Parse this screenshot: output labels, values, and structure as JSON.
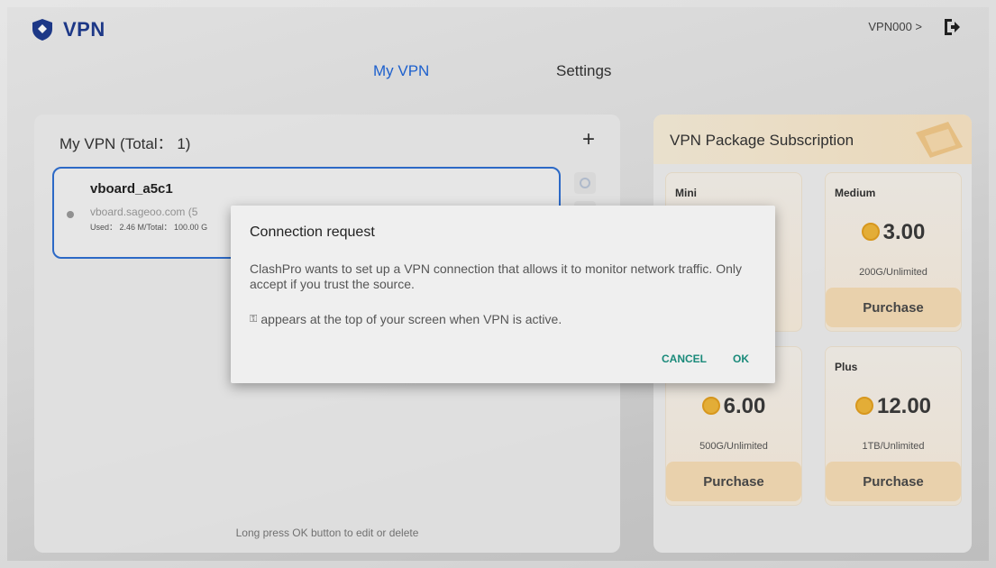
{
  "header": {
    "brand": "VPN",
    "user_label": "VPN000 >"
  },
  "nav": {
    "tabs": [
      {
        "label": "My VPN"
      },
      {
        "label": "Settings"
      }
    ]
  },
  "my_vpn": {
    "title": "My VPN (Total： 1)",
    "add_label": "+",
    "items": [
      {
        "name": "vboard_a5c1",
        "host": "vboard.sageoo.com  (5",
        "usage": "Used： 2.46 M/Total： 100.00 G"
      }
    ],
    "hint": "Long press OK button to edit or delete"
  },
  "subscription": {
    "title": "VPN Package Subscription",
    "packages": [
      {
        "name": "Mini",
        "price": "",
        "quota": "",
        "button": ""
      },
      {
        "name": "Medium",
        "price": "3.00",
        "quota": "200G/Unlimited",
        "button": "Purchase"
      },
      {
        "name": "",
        "price": "6.00",
        "quota": "500G/Unlimited",
        "button": "Purchase"
      },
      {
        "name": "Plus",
        "price": "12.00",
        "quota": "1TB/Unlimited",
        "button": "Purchase"
      }
    ]
  },
  "dialog": {
    "title": "Connection request",
    "body": "ClashPro wants to set up a VPN connection that allows it to monitor network traffic. Only accept if you trust the source.",
    "note": "appears at the top of your screen when VPN is active.",
    "cancel": "CANCEL",
    "ok": "OK"
  },
  "colors": {
    "accent": "#1f66d9",
    "brand": "#1f3b8f",
    "dialog_button": "#1a8a7a",
    "purchase": "#f6ddb6"
  },
  "icons": [
    "shield-logo-icon",
    "logout-icon",
    "add-icon",
    "settings-gear-icon",
    "coin-icon",
    "key-icon"
  ]
}
